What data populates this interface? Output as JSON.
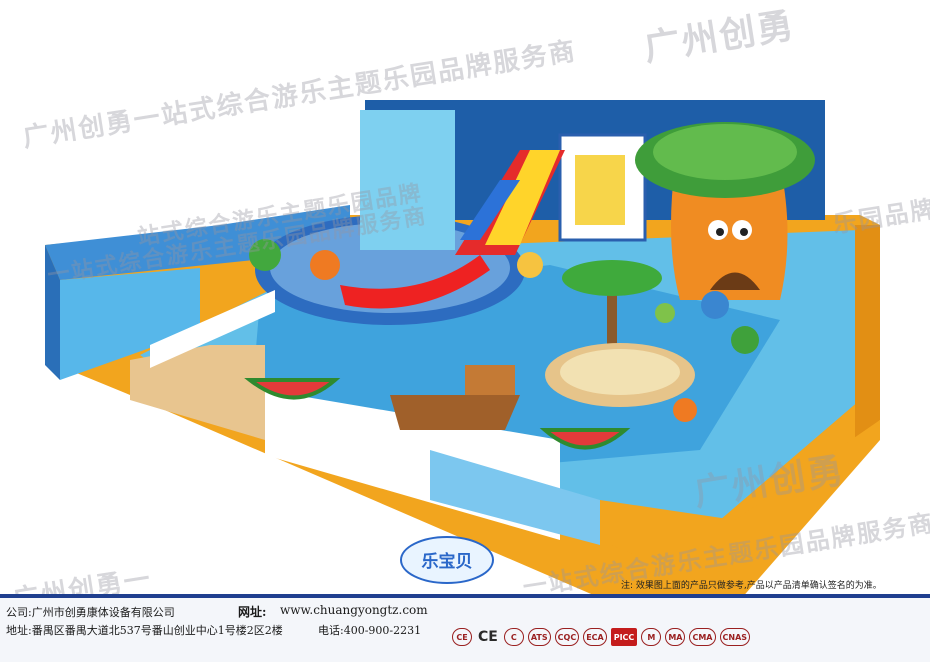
{
  "image": {
    "description_elements": [
      "playground-scene"
    ]
  },
  "watermarks": {
    "slogan_line1": "广州创勇一站式综合游乐主题乐园品牌服务商",
    "slogan_line2": "一站式综合游乐主题乐园品牌服务商",
    "brand_short": "广州创勇",
    "slogan_mid": "站式综合游乐主题乐园品牌",
    "slogan_right": "乐园品牌",
    "slogan_bottom": "一站式综合游乐主题乐园品牌服务商",
    "slogan_bottom_left": "广州创勇一",
    "brand_right": "广州创勇"
  },
  "logo": {
    "name": "乐宝贝"
  },
  "note": "注: 效果图上面的产品只做参考,产品以产品清单确认签名的为准。",
  "footer": {
    "company": "公司:广州市创勇康体设备有限公司",
    "address": "地址:番禺区番禺大道北537号番山创业中心1号楼2区2楼",
    "website_label": "网址:",
    "website": "www.chuangyongtz.com",
    "phone": "电话:400-900-2231",
    "certifications": [
      "CE",
      "CE",
      "C",
      "ATS",
      "CQC",
      "ECA",
      "PICC",
      "M",
      "MA",
      "CMA",
      "CNAS"
    ]
  }
}
